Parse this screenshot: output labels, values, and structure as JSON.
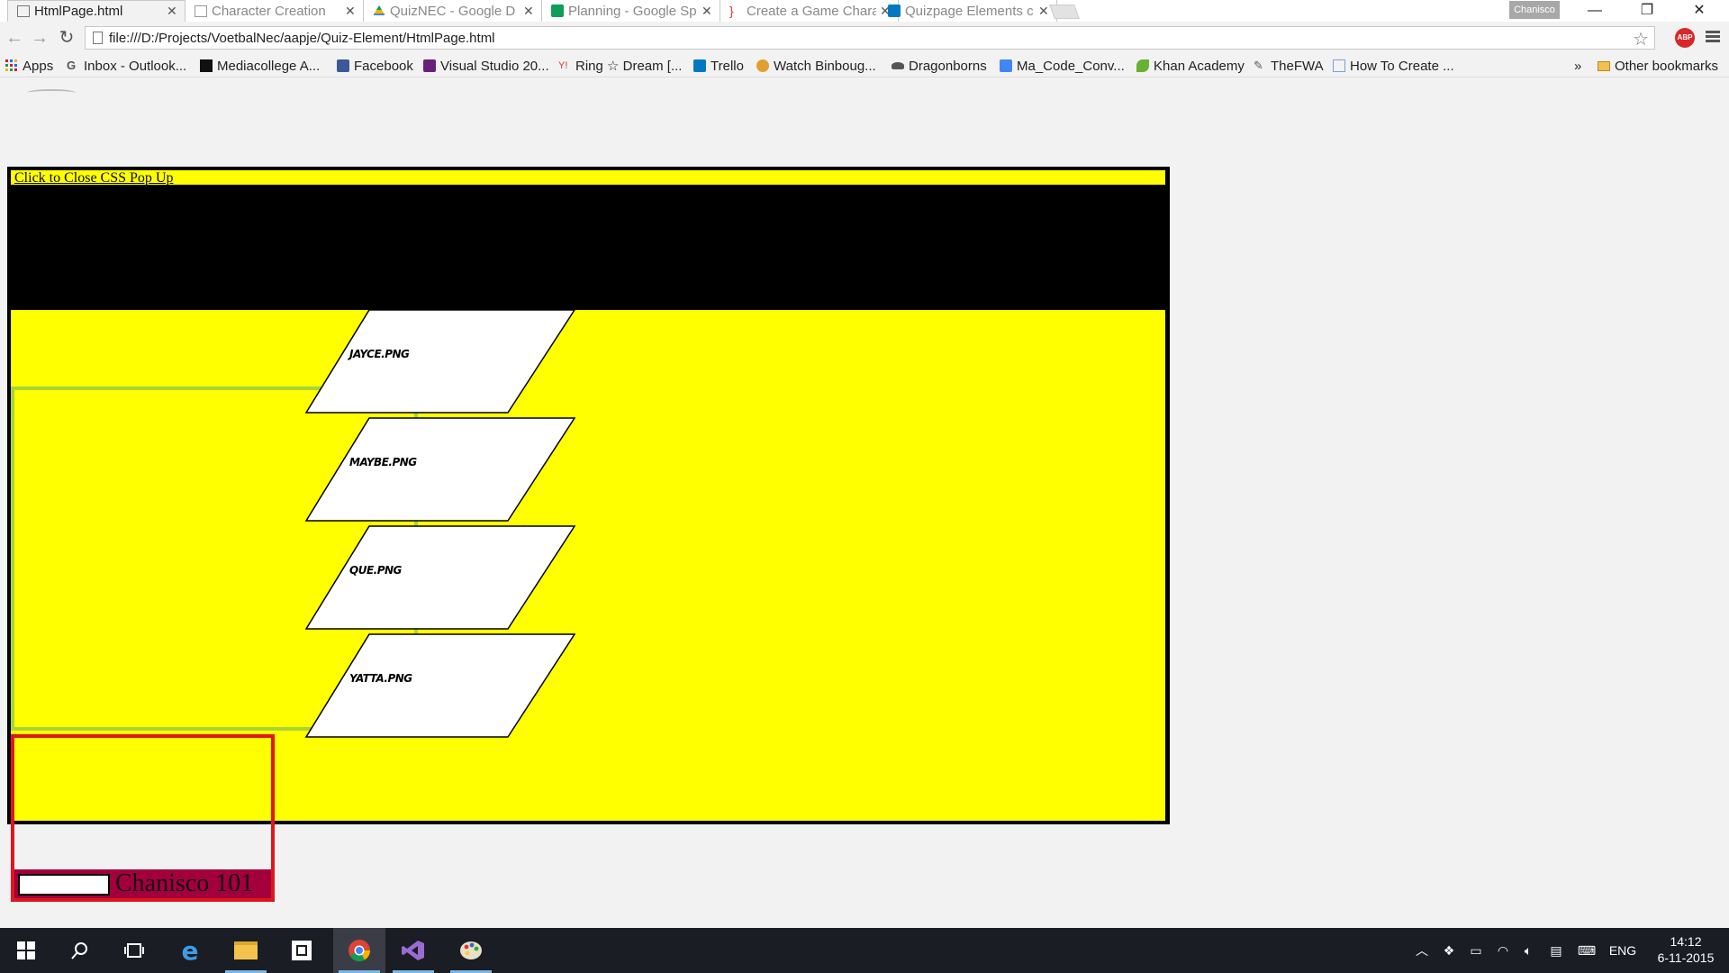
{
  "browser": {
    "tabs": [
      {
        "title": "HtmlPage.html",
        "active": true,
        "icon": "page-icon"
      },
      {
        "title": "Character Creation",
        "active": false,
        "icon": "page-icon"
      },
      {
        "title": "QuizNEC - Google D",
        "active": false,
        "icon": "google-drive-icon"
      },
      {
        "title": "Planning - Google Sp",
        "active": false,
        "icon": "google-sheets-icon"
      },
      {
        "title": "Create a Game Chara",
        "active": false,
        "icon": "bracket-icon"
      },
      {
        "title": "Quizpage Elements c",
        "active": false,
        "icon": "trello-icon"
      }
    ],
    "profile_name": "Chanisco",
    "address": "file:///D:/Projects/VoetbalNec/aapje/Quiz-Element/HtmlPage.html",
    "adblock_label": "ABP",
    "bookmarks": [
      {
        "label": "Apps",
        "icon": "apps-grid-icon"
      },
      {
        "label": "Inbox - Outlook...",
        "icon": "google-icon"
      },
      {
        "label": "Mediacollege A...",
        "icon": "mediacollege-icon"
      },
      {
        "label": "Facebook",
        "icon": "facebook-icon"
      },
      {
        "label": "Visual Studio 20...",
        "icon": "visual-studio-icon"
      },
      {
        "label": "Ring ☆ Dream [...",
        "icon": "bookmark-site-icon"
      },
      {
        "label": "Trello",
        "icon": "trello-icon"
      },
      {
        "label": "Watch Binboug...",
        "icon": "bookmark-site-icon"
      },
      {
        "label": "Dragonborns",
        "icon": "bookmark-site-icon"
      },
      {
        "label": "Ma_Code_Conv...",
        "icon": "google-docs-icon"
      },
      {
        "label": "Khan Academy",
        "icon": "khan-academy-icon"
      },
      {
        "label": "TheFWA",
        "icon": "bookmark-site-icon"
      },
      {
        "label": "How To Create ...",
        "icon": "bookmark-site-icon"
      }
    ],
    "overflow_label": "»",
    "other_bookmarks": "Other bookmarks"
  },
  "popup": {
    "close_link": "Click to Close CSS Pop Up",
    "options": [
      "JAYCE.PNG",
      "MAYBE.PNG",
      "QUE.PNG",
      "YATTA.PNG"
    ],
    "player_name": "Chanisco  101",
    "name_input_value": ""
  },
  "taskbar": {
    "language": "ENG",
    "time": "14:12",
    "date": "6-11-2015"
  },
  "colors": {
    "stage_yellow": "#ffff00",
    "popup_black": "#000000",
    "green_border": "#a8d534",
    "red_border": "#e0161e",
    "name_strip": "#a3003b"
  }
}
